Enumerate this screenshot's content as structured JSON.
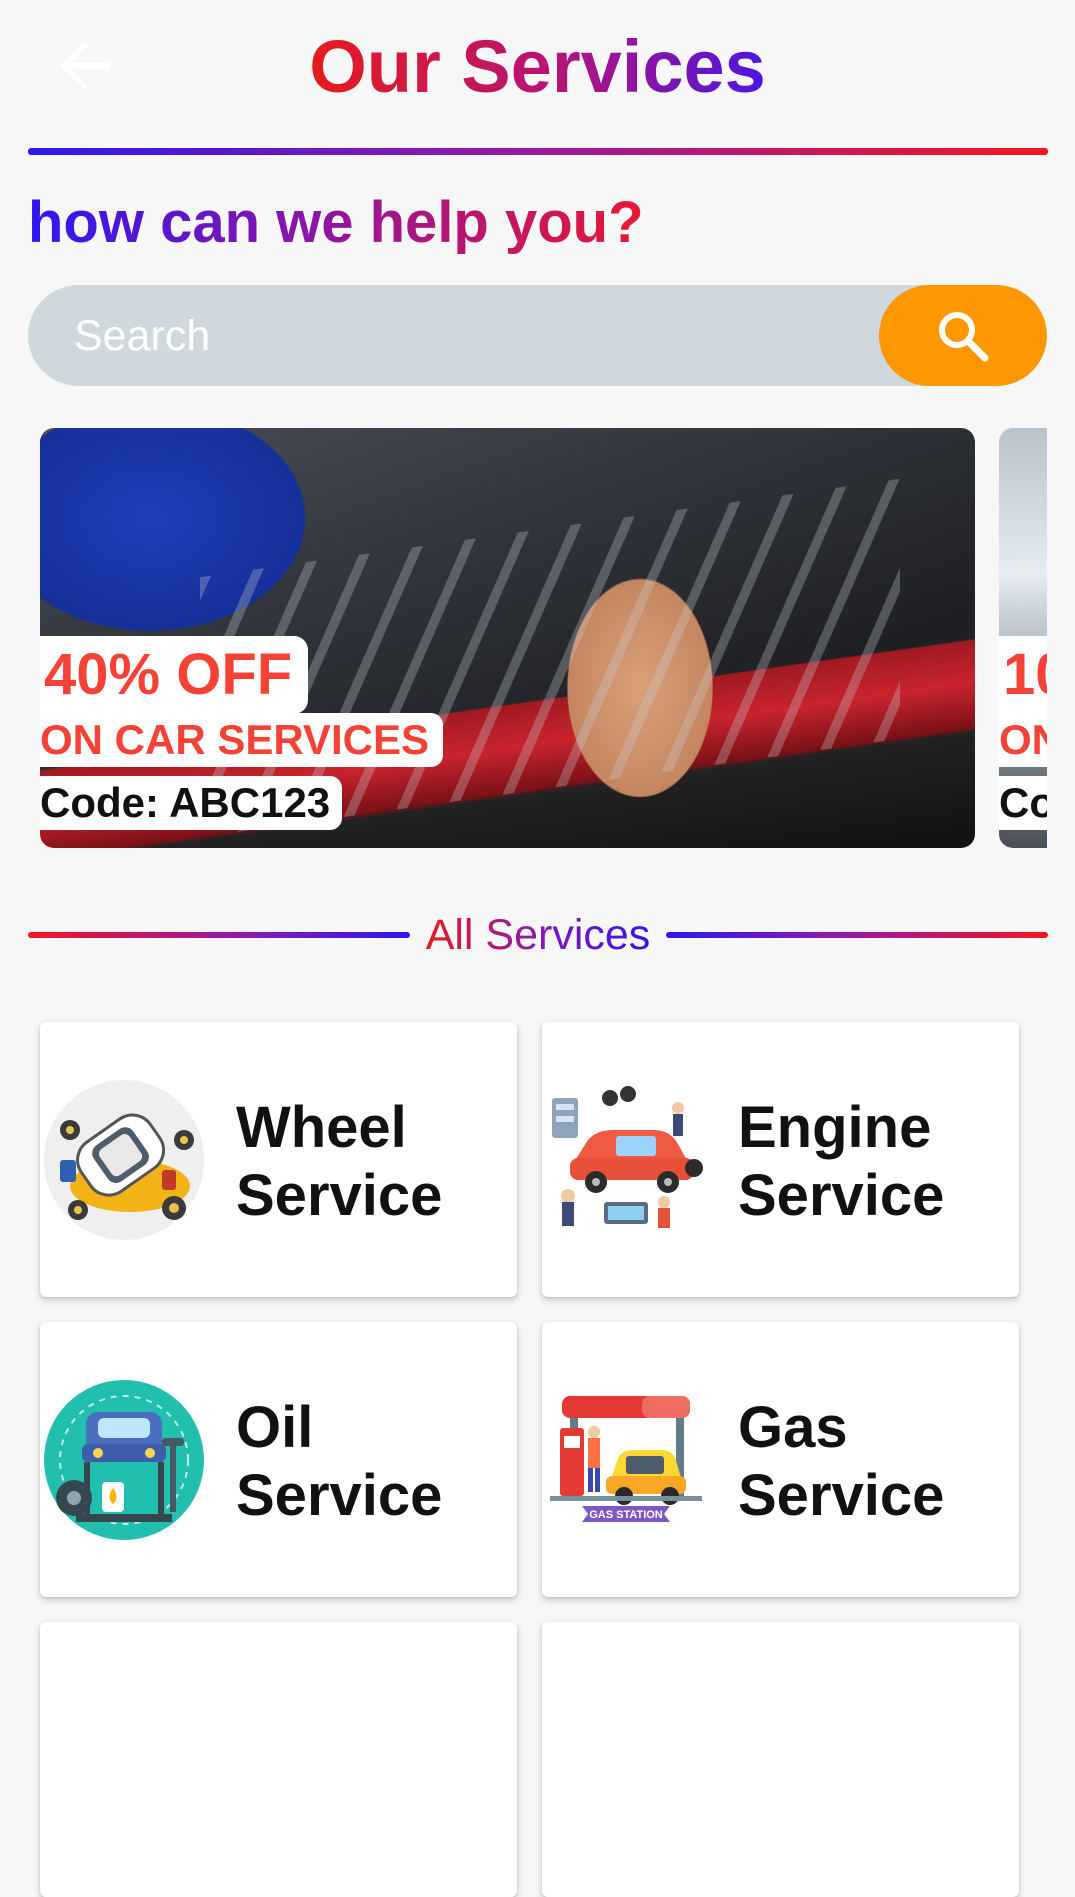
{
  "header": {
    "title": "Our Services",
    "back_icon": "arrow-back-icon"
  },
  "help": {
    "heading": "how can we help you?"
  },
  "search": {
    "placeholder": "Search",
    "value": "",
    "button_icon": "search-icon",
    "button_color": "#ff9800"
  },
  "carousel": {
    "banners": [
      {
        "discount": "40% OFF",
        "subtitle": "ON CAR SERVICES",
        "code": "Code: ABC123"
      },
      {
        "discount": "10",
        "subtitle": "ON",
        "code": "Co"
      }
    ]
  },
  "section": {
    "label": "All Services"
  },
  "services": [
    {
      "line1": "Wheel",
      "line2": "Service",
      "icon": "wheel-service-illustration"
    },
    {
      "line1": "Engine",
      "line2": "Service",
      "icon": "engine-service-illustration"
    },
    {
      "line1": "Oil",
      "line2": "Service",
      "icon": "oil-service-illustration"
    },
    {
      "line1": "Gas",
      "line2": "Service",
      "icon": "gas-station-illustration"
    }
  ],
  "illustrations": {
    "gas_station_sign": "GAS STATION"
  },
  "colors": {
    "accent_orange": "#ff9800",
    "offer_red": "#f44336",
    "gradient_red": "#f5151f",
    "gradient_blue": "#2d17f2"
  }
}
